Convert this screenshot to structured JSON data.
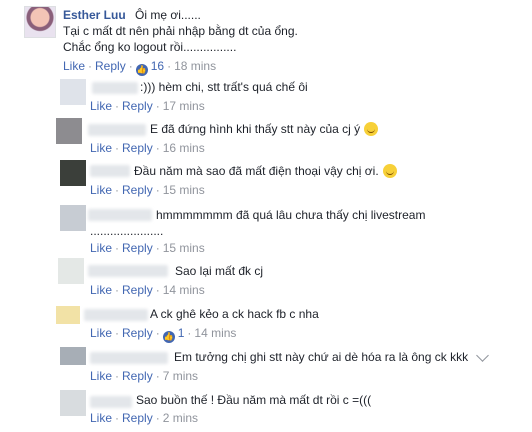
{
  "post": {
    "author": "Esther Luu",
    "first_line": "Ôi mẹ ơi......",
    "lines": [
      "Tại c mất dt nên phải nhập bằng dt của ổng.",
      "Chắc ổng ko logout rồi................"
    ],
    "actions": {
      "like": "Like",
      "reply": "Reply",
      "reactions": "16",
      "time": "18 mins"
    }
  },
  "replies": [
    {
      "text": ":))) hèm chi, stt trất's quá chế ôi",
      "time": "17 mins"
    },
    {
      "text": "E đã đứng hình khi thấy stt này của cj ý",
      "time": "16 mins",
      "emoji": "smile-emoji-icon"
    },
    {
      "text": "Đầu năm mà sao đã mất điện thoại vậy chị ơi.",
      "time": "15 mins",
      "emoji": "wink-emoji-icon"
    },
    {
      "text": "hmmmmmmm đã quá lâu chưa thấy chị livestream",
      "text2": "......................",
      "time": "15 mins"
    },
    {
      "text": "Sao lại mất đk cj",
      "time": "14 mins"
    },
    {
      "text": "A ck ghê kẻo a ck hack fb c nha",
      "time": "14 mins",
      "reactions": "1"
    },
    {
      "text": "Em tưởng chị ghi stt này chứ ai dè hóa ra là ông ck kkk",
      "time": "7 mins"
    },
    {
      "text": "Sao buồn thế ! Đầu năm mà mất dt rồi c =(((",
      "time": "2 mins"
    }
  ],
  "labels": {
    "like": "Like",
    "reply": "Reply",
    "dot": "·"
  }
}
